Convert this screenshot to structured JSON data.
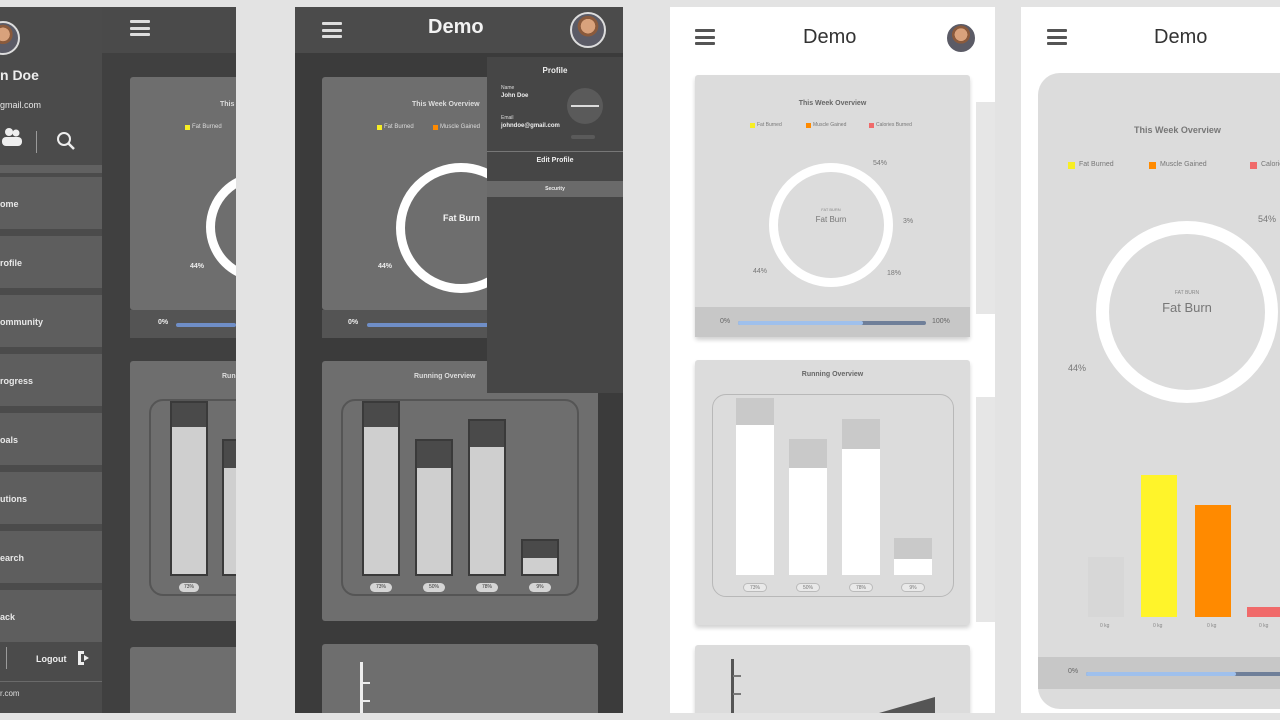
{
  "app": {
    "title": "Demo"
  },
  "user": {
    "name": "n Doe",
    "email": "gmail.com"
  },
  "nav": {
    "items": [
      {
        "label": "ome"
      },
      {
        "label": "rofile"
      },
      {
        "label": "ommunity"
      },
      {
        "label": "rogress"
      },
      {
        "label": "oals"
      },
      {
        "label": "utions"
      },
      {
        "label": "earch"
      },
      {
        "label": "ack"
      }
    ],
    "logout_label": "Logout",
    "footer_label": "r.com"
  },
  "profile_menu": {
    "title": "Profile",
    "name_label": "Name",
    "name_value": "John Doe",
    "email_label": "Email",
    "email_value": "johndoe@gmail.com",
    "action_label": "Edit Profile",
    "section_label": "Security"
  },
  "overview": {
    "title": "This Week Overview",
    "center_sub": "FAT BURN",
    "center_label": "Fat Burn",
    "short_label": "Fat Burn",
    "legend": [
      {
        "name": "Fat Burned",
        "color": "#f7ee24"
      },
      {
        "name": "Muscle Gained",
        "color": "#ff8a00"
      },
      {
        "name": "Calories Burned",
        "color": "#f06a6a"
      }
    ],
    "labels": {
      "top_right": "54%",
      "right": "3%",
      "bottom_right": "18%",
      "left": "44%"
    },
    "progress": {
      "start": "0%",
      "end": "100%",
      "value": 0.7
    },
    "bars": [
      {
        "label": "0 kg",
        "value": 0.4,
        "color": "#d7d7d7"
      },
      {
        "label": "0 kg",
        "value": 0.95,
        "color": "#fff42a"
      },
      {
        "label": "0 kg",
        "value": 0.75,
        "color": "#ff8a00"
      },
      {
        "label": "0 kg",
        "value": 0.06,
        "color": "#f06a6a"
      }
    ]
  },
  "running": {
    "title": "Running Overview",
    "bars": [
      {
        "label": "73%",
        "value": 0.86
      },
      {
        "label": "50%",
        "value": 0.72
      },
      {
        "label": "78%",
        "value": 0.8
      },
      {
        "label": "9%",
        "value": 0.12
      }
    ]
  }
}
